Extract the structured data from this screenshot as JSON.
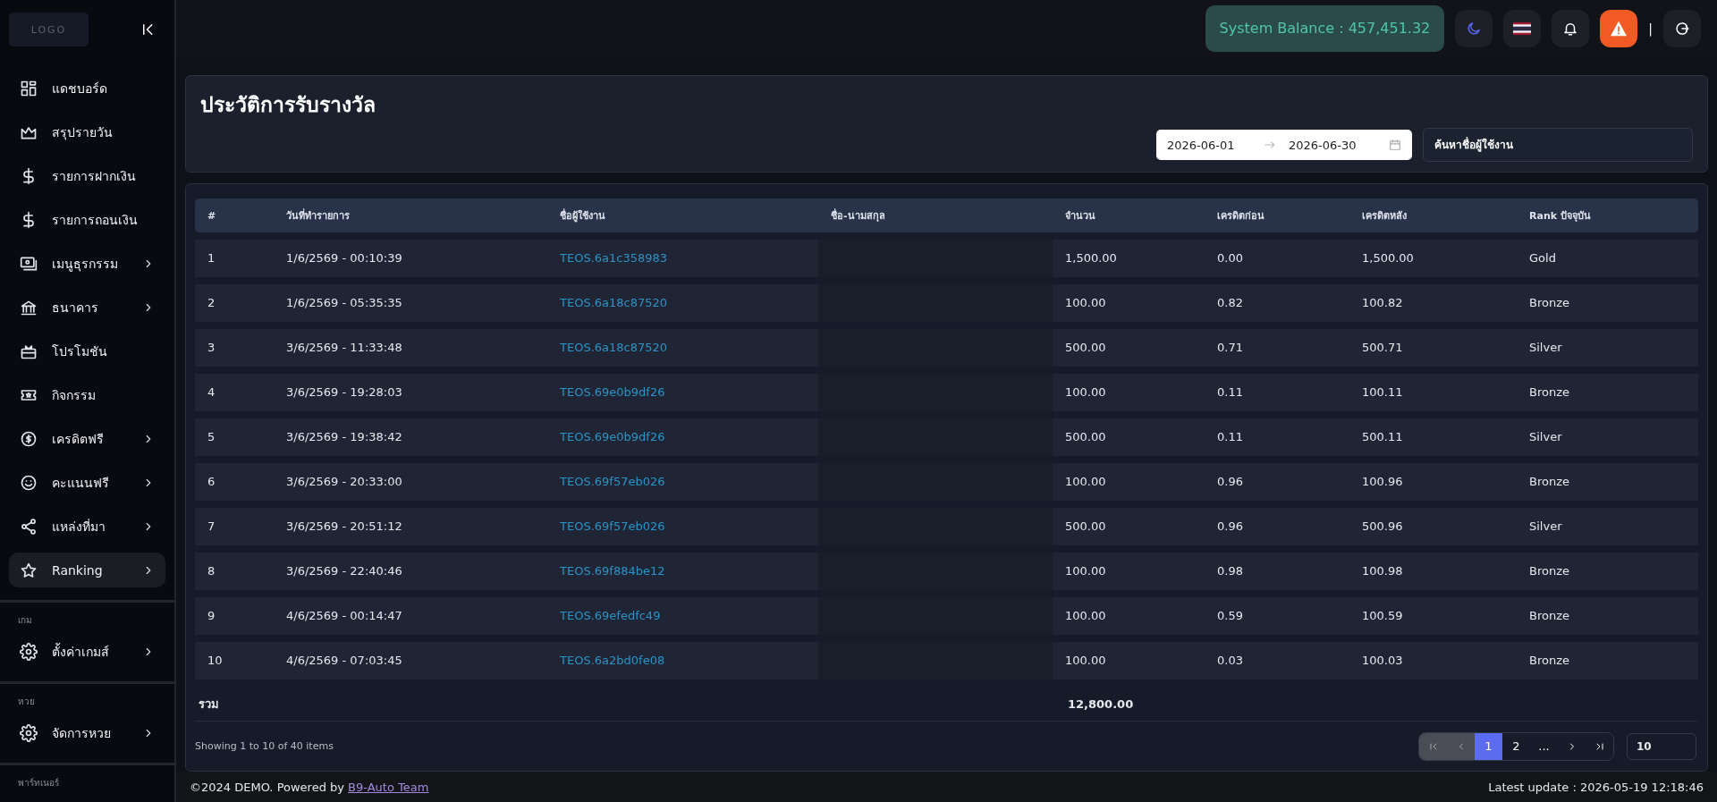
{
  "sidebar": {
    "logo": "LOGO",
    "items": [
      {
        "label": "แดชบอร์ด",
        "expandable": false,
        "selected": false
      },
      {
        "label": "สรุปรายวัน",
        "expandable": false,
        "selected": false
      },
      {
        "label": "รายการฝากเงิน",
        "expandable": false,
        "selected": false
      },
      {
        "label": "รายการถอนเงิน",
        "expandable": false,
        "selected": false
      },
      {
        "label": "เมนูธุรกรรม",
        "expandable": true,
        "selected": false
      },
      {
        "label": "ธนาคาร",
        "expandable": true,
        "selected": false
      },
      {
        "label": "โปรโมชัน",
        "expandable": false,
        "selected": false
      },
      {
        "label": "กิจกรรม",
        "expandable": false,
        "selected": false
      },
      {
        "label": "เครดิตฟรี",
        "expandable": true,
        "selected": false
      },
      {
        "label": "คะแนนฟรี",
        "expandable": true,
        "selected": false
      },
      {
        "label": "แหล่งที่มา",
        "expandable": true,
        "selected": false
      },
      {
        "label": "Ranking",
        "expandable": true,
        "selected": true
      }
    ],
    "sections": [
      {
        "title": "เกม",
        "items": [
          {
            "label": "ตั้งค่าเกมส์",
            "expandable": true,
            "selected": false
          }
        ]
      },
      {
        "title": "หวย",
        "items": [
          {
            "label": "จัดการหวย",
            "expandable": true,
            "selected": false
          }
        ]
      },
      {
        "title": "พาร์ทเนอร์"
      }
    ]
  },
  "topbar": {
    "balance": "System Balance : 457,451.32",
    "separator": "|"
  },
  "page": {
    "title": "ประวัติการรับรางวัล",
    "date_from": "2026-06-01",
    "date_to": "2026-06-30",
    "search_placeholder": "ค้นหาชื่อผู้ใช้งาน"
  },
  "table": {
    "columns": [
      "#",
      "วันที่ทำรายการ",
      "ชื่อผู้ใช้งาน",
      "ชื่อ-นามสกุล",
      "จำนวน",
      "เครดิตก่อน",
      "เครดิตหลัง",
      "Rank ปัจจุบัน"
    ],
    "rows": [
      [
        "1",
        "1/6/2569 - 00:10:39",
        "TEOS.6a1c358983",
        "",
        "1,500.00",
        "0.00",
        "1,500.00",
        "Gold"
      ],
      [
        "2",
        "1/6/2569 - 05:35:35",
        "TEOS.6a18c87520",
        "",
        "100.00",
        "0.82",
        "100.82",
        "Bronze"
      ],
      [
        "3",
        "3/6/2569 - 11:33:48",
        "TEOS.6a18c87520",
        "",
        "500.00",
        "0.71",
        "500.71",
        "Silver"
      ],
      [
        "4",
        "3/6/2569 - 19:28:03",
        "TEOS.69e0b9df26",
        "",
        "100.00",
        "0.11",
        "100.11",
        "Bronze"
      ],
      [
        "5",
        "3/6/2569 - 19:38:42",
        "TEOS.69e0b9df26",
        "",
        "500.00",
        "0.11",
        "500.11",
        "Silver"
      ],
      [
        "6",
        "3/6/2569 - 20:33:00",
        "TEOS.69f57eb026",
        "",
        "100.00",
        "0.96",
        "100.96",
        "Bronze"
      ],
      [
        "7",
        "3/6/2569 - 20:51:12",
        "TEOS.69f57eb026",
        "",
        "500.00",
        "0.96",
        "500.96",
        "Silver"
      ],
      [
        "8",
        "3/6/2569 - 22:40:46",
        "TEOS.69f884be12",
        "",
        "100.00",
        "0.98",
        "100.98",
        "Bronze"
      ],
      [
        "9",
        "4/6/2569 - 00:14:47",
        "TEOS.69efedfc49",
        "",
        "100.00",
        "0.59",
        "100.59",
        "Bronze"
      ],
      [
        "10",
        "4/6/2569 - 07:03:45",
        "TEOS.6a2bd0fe08",
        "",
        "100.00",
        "0.03",
        "100.03",
        "Bronze"
      ]
    ],
    "total_label": "รวม",
    "total_amount": "12,800.00"
  },
  "pagination": {
    "info": "Showing 1 to 10 of 40 items",
    "pages": [
      {
        "label": "1",
        "selected": true
      },
      {
        "label": "2",
        "selected": false
      },
      {
        "label": "...",
        "selected": false
      }
    ],
    "first_disabled": true,
    "prev_disabled": true,
    "page_size": "10"
  },
  "footer": {
    "copyright": "©2024 DEMO. Powered by ",
    "link": "B9-Auto Team",
    "updated": "Latest update : 2026-05-19 12:18:46"
  }
}
